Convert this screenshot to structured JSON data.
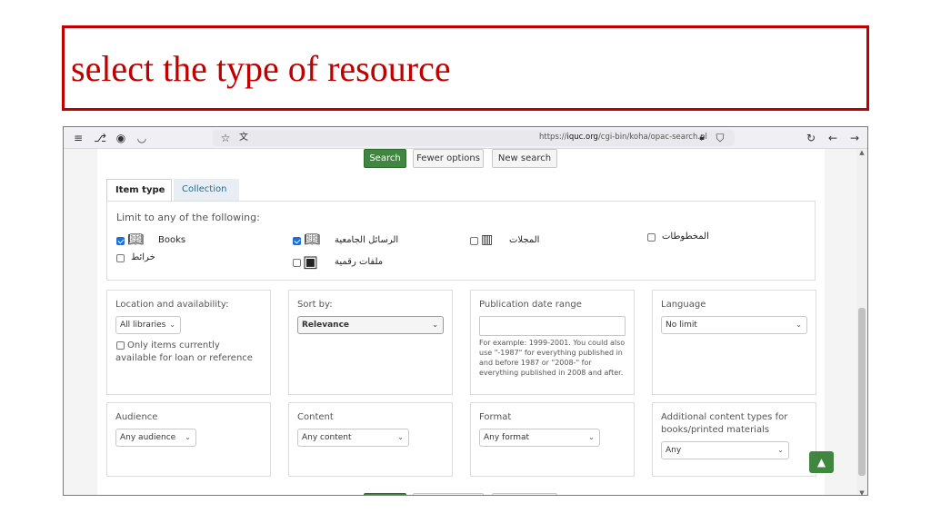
{
  "slide": {
    "title": "select the type of resource"
  },
  "browser": {
    "url_prefix": "https://",
    "url_domain": "iquc.org",
    "url_path": "/cgi-bin/koha/opac-search.pl",
    "icons": [
      "menu-icon",
      "extension-icon",
      "account-icon",
      "pocket-icon",
      "bookmark-star-icon",
      "translate-icon",
      "lock-icon",
      "shield-icon",
      "reload-icon",
      "back-icon",
      "forward-icon"
    ]
  },
  "actions": {
    "search": "Search",
    "fewer": "Fewer options",
    "new_search": "New search"
  },
  "tabs": {
    "item_type": "Item type",
    "collection": "Collection"
  },
  "limit": {
    "heading": "Limit to any of the following:",
    "books": "Books",
    "theses": "الرسائل الجامعية",
    "journals": "المجلات",
    "manuscripts": "المخطوطات",
    "maps": "خرائط",
    "digital": "ملفات رقمية"
  },
  "filters": {
    "location": {
      "label": "Location and availability:",
      "value": "All libraries",
      "only_items": "Only items currently",
      "only_items2": "available for loan or reference"
    },
    "sort": {
      "label": "Sort by:",
      "value": "Relevance"
    },
    "pubdate": {
      "label": "Publication date range",
      "hint1": "For example: 1999-2001. You could also",
      "hint2": "use \"-1987\" for everything published in",
      "hint3": "and before 1987 or \"2008-\" for",
      "hint4": "everything published in 2008 and after."
    },
    "language": {
      "label": "Language",
      "value": "No limit"
    },
    "audience": {
      "label": "Audience",
      "value": "Any audience"
    },
    "content": {
      "label": "Content",
      "value": "Any content"
    },
    "format": {
      "label": "Format",
      "value": "Any format"
    },
    "additional": {
      "label1": "Additional content types for",
      "label2": "books/printed materials",
      "value": "Any"
    }
  }
}
